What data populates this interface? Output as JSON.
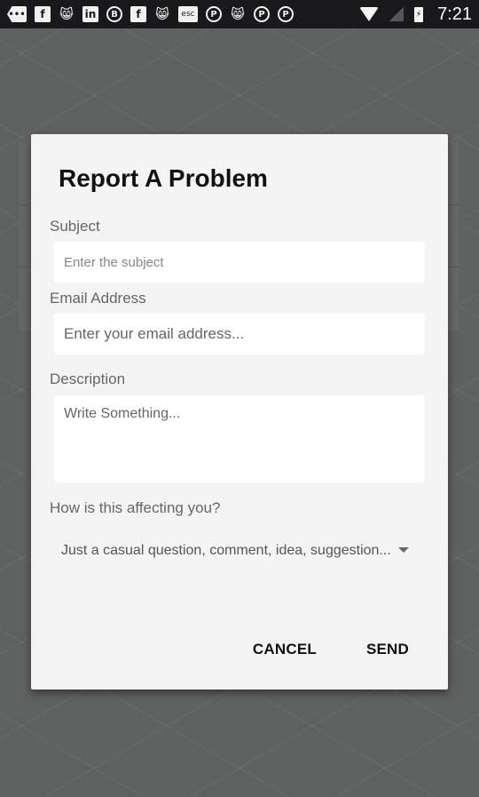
{
  "status_bar": {
    "notification_icons": [
      {
        "name": "messages-icon",
        "glyph": "•••",
        "style": "dots"
      },
      {
        "name": "facebook-icon",
        "glyph": "f",
        "style": ""
      },
      {
        "name": "cat-app-icon",
        "glyph": "😸",
        "style": "cat"
      },
      {
        "name": "linkedin-icon",
        "glyph": "in",
        "style": ""
      },
      {
        "name": "bitcoin-chat-icon",
        "glyph": "B",
        "style": "round"
      },
      {
        "name": "facebook-icon",
        "glyph": "f",
        "style": ""
      },
      {
        "name": "cat-app-icon",
        "glyph": "😸",
        "style": "cat"
      },
      {
        "name": "esc-icon",
        "glyph": "esc",
        "style": "esc"
      },
      {
        "name": "pinterest-icon",
        "glyph": "P",
        "style": "round"
      },
      {
        "name": "cat-app-icon",
        "glyph": "😸",
        "style": "cat"
      },
      {
        "name": "pinterest-icon",
        "glyph": "P",
        "style": "round"
      },
      {
        "name": "pinterest-icon",
        "glyph": "P",
        "style": "round"
      }
    ],
    "battery_glyph": "⚡",
    "time": "7:21"
  },
  "dialog": {
    "title": "Report A Problem",
    "subject": {
      "label": "Subject",
      "placeholder": "Enter the subject",
      "value": ""
    },
    "email": {
      "label": "Email Address",
      "placeholder": "Enter your email address...",
      "value": ""
    },
    "description": {
      "label": "Description",
      "placeholder": "Write Something...",
      "value": ""
    },
    "impact": {
      "label": "How is this affecting you?",
      "selected": "Just a casual question, comment, idea, suggestion..."
    },
    "actions": {
      "cancel": "CANCEL",
      "send": "SEND"
    }
  },
  "colors": {
    "dialog_bg": "#f4f4f4",
    "scrim": "#5f6160",
    "status_bar": "#19191b"
  }
}
